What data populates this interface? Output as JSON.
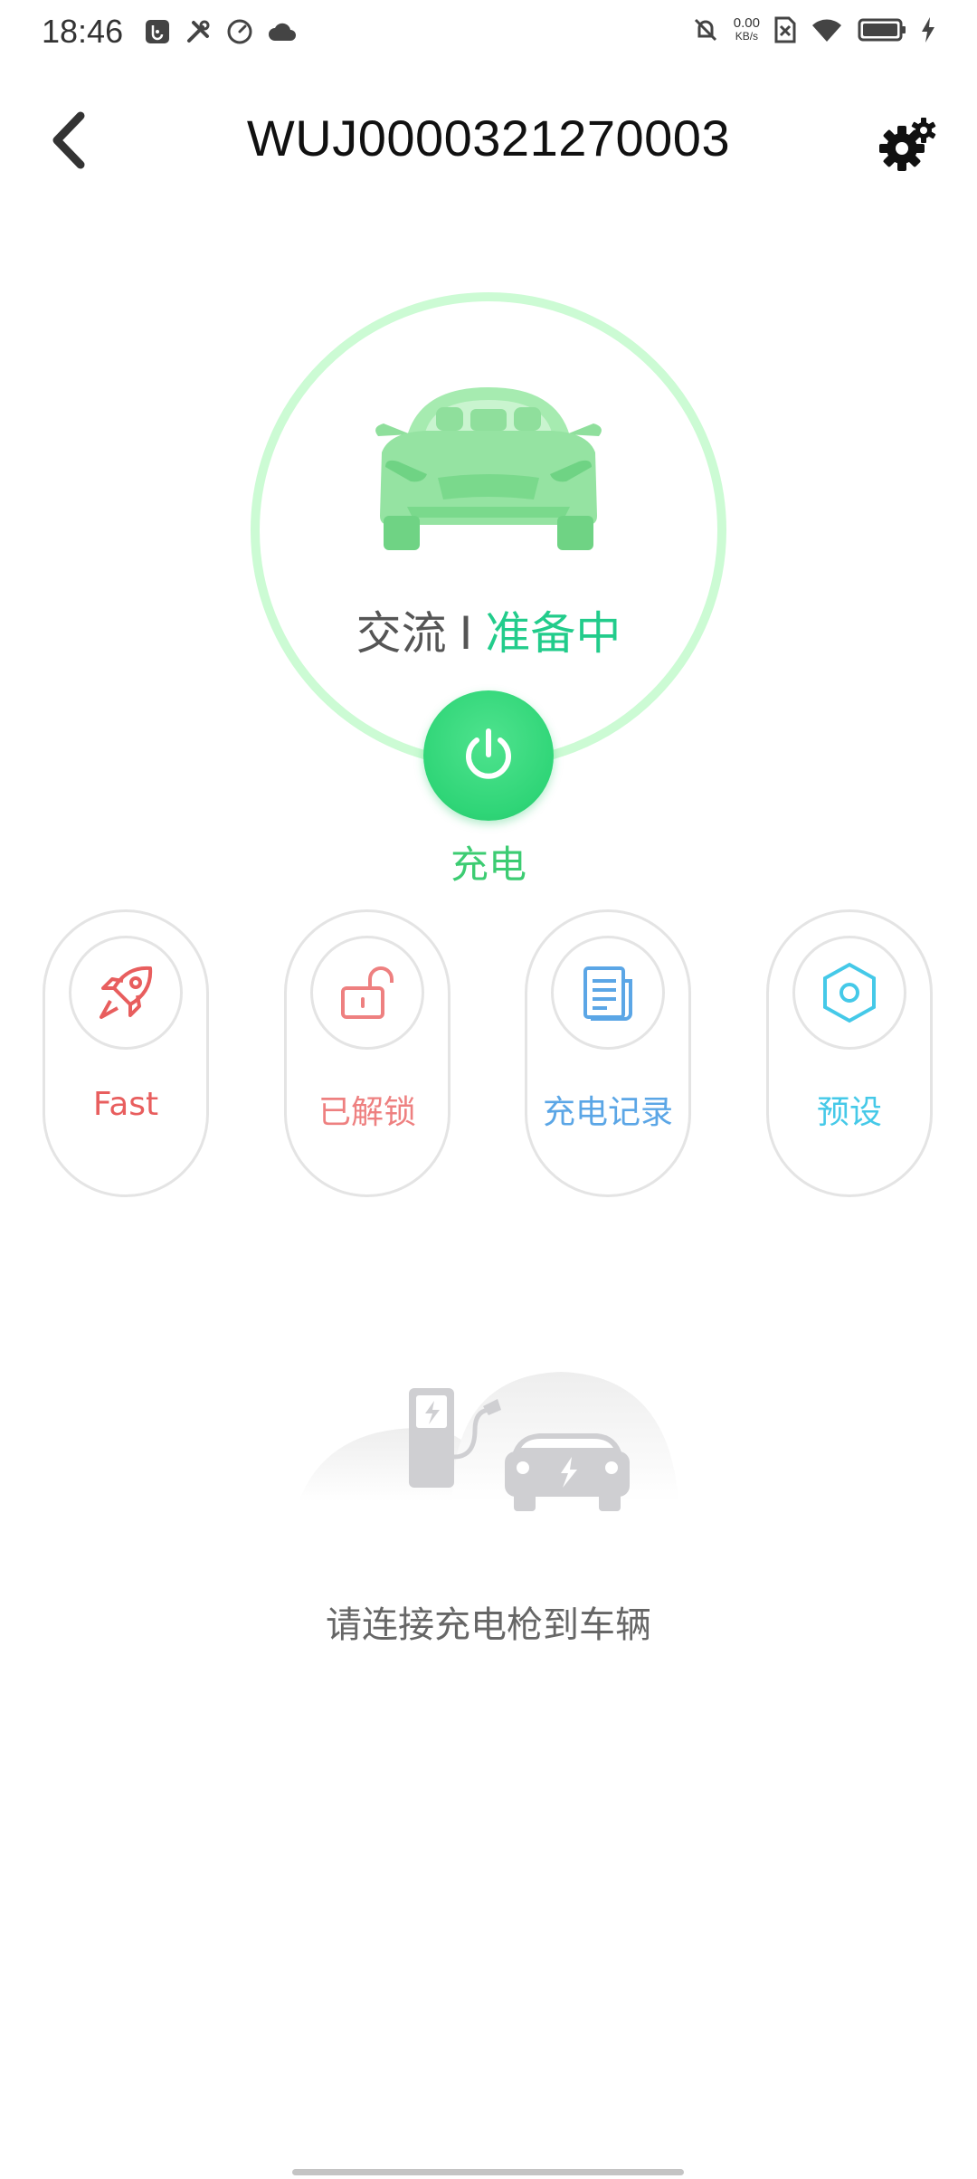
{
  "status_bar": {
    "time": "18:46",
    "net_speed_value": "0.00",
    "net_speed_unit": "KB/s",
    "left_icons": [
      "usb-debug-icon",
      "tools-icon",
      "speedometer-icon",
      "cloud-icon"
    ],
    "right_icons": [
      "alarm-off-icon",
      "sim-off-icon",
      "wifi-icon",
      "battery-icon",
      "charging-bolt-icon"
    ]
  },
  "header": {
    "title": "WUJ0000321270003",
    "back_icon": "chevron-left-icon",
    "settings_icon": "gears-icon"
  },
  "charger": {
    "mode": "交流",
    "separator": "I",
    "status": "准备中",
    "power_label": "充电",
    "ring_color": "#ccfbd4",
    "status_color": "#22cc8b",
    "button_color": "#2fd577"
  },
  "actions": [
    {
      "label": "Fast",
      "icon": "rocket-icon",
      "color": "#e85e5e"
    },
    {
      "label": "已解锁",
      "icon": "unlock-icon",
      "color": "#ee8080"
    },
    {
      "label": "充电记录",
      "icon": "document-icon",
      "color": "#5ba6e6"
    },
    {
      "label": "预设",
      "icon": "hexagon-settings-icon",
      "color": "#45c9e8"
    }
  ],
  "empty_state": {
    "message": "请连接充电枪到车辆"
  }
}
